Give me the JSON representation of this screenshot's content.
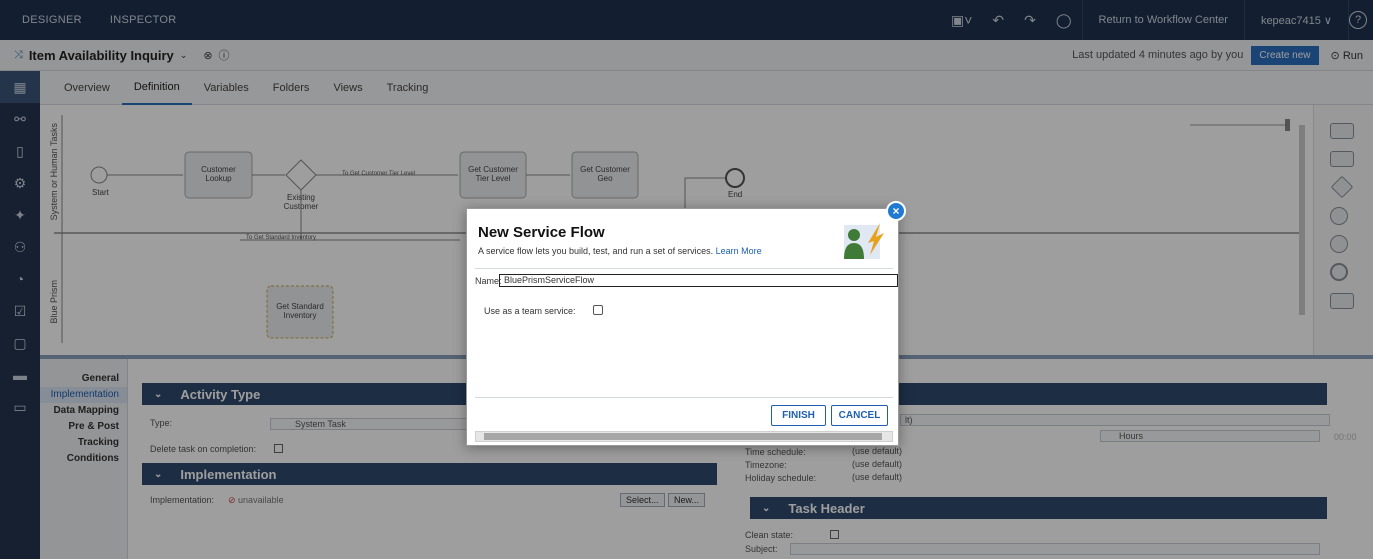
{
  "topbar": {
    "designer": "DESIGNER",
    "inspector": "INSPECTOR",
    "return_link": "Return to Workflow Center",
    "user": "kepeac7415 ∨",
    "help": "?"
  },
  "header": {
    "title": "Item Availability Inquiry",
    "updated": "Last updated 4 minutes ago by you",
    "create_new": "Create new",
    "run": "Run"
  },
  "tabs": [
    "Overview",
    "Definition",
    "Variables",
    "Folders",
    "Views",
    "Tracking"
  ],
  "diagram": {
    "lane1": "System or Human Tasks",
    "lane2": "Blue Prism",
    "nodes": {
      "start": "Start",
      "customer_lookup": "Customer Lookup",
      "existing_customer": "Existing Customer",
      "get_tier": "Get Customer Tier Level",
      "get_geo": "Get Customer Geo",
      "end": "End",
      "get_inventory": "Get Standard Inventory"
    },
    "flows": {
      "to_tier": "To Get Customer Tier Level",
      "to_inventory": "To Get Standard Inventory"
    }
  },
  "props": {
    "side": [
      "General",
      "Implementation",
      "Data Mapping",
      "Pre & Post",
      "Tracking",
      "Conditions"
    ],
    "activity_type": "Activity Type",
    "type_label": "Type:",
    "type_value": "System Task",
    "delete_label": "Delete task on completion:",
    "implementation": "Implementation",
    "impl_label": "Implementation:",
    "impl_value": "unavailable",
    "select": "Select...",
    "new": "New...",
    "hours": "Hours",
    "hours_val": "00:00",
    "time_schedule": "Time schedule:",
    "timezone": "Timezone:",
    "holiday_schedule": "Holiday schedule:",
    "use_default": "(use default)",
    "task_header": "Task Header",
    "clean_state": "Clean state:",
    "subject": "Subject:",
    "right_value": "lt)"
  },
  "modal": {
    "title": "New Service Flow",
    "subtitle": "A service flow lets you build, test, and run a set of services.",
    "learn_more": "Learn More",
    "name_label": "Name:",
    "name_value": "BluePrismServiceFlow",
    "team_label": "Use as a team service:",
    "finish": "FINISH",
    "cancel": "CANCEL",
    "close": "×"
  }
}
